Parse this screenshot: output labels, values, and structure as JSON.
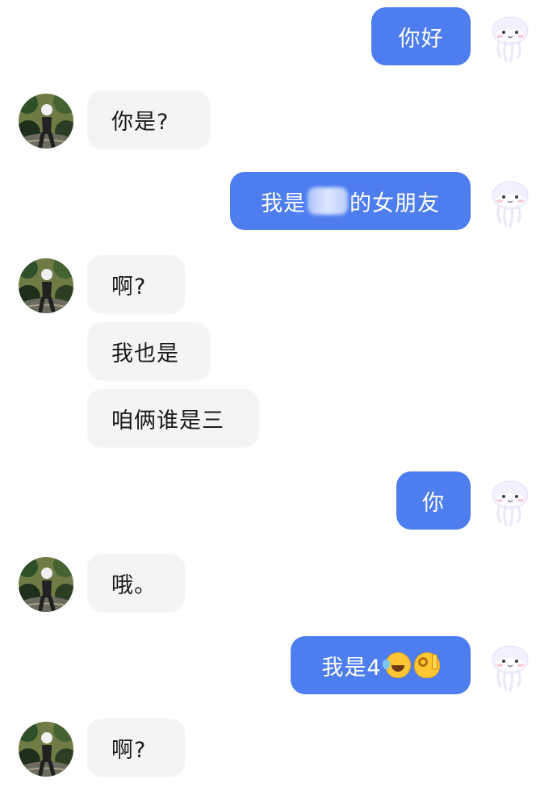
{
  "conversation": {
    "messages": [
      {
        "speaker": "me",
        "text": "你好"
      },
      {
        "speaker": "contact",
        "text": "你是?"
      },
      {
        "speaker": "me",
        "text_before": "我是",
        "text_after": "的女朋友"
      },
      {
        "speaker": "contact",
        "text": "啊?"
      },
      {
        "speaker": "contact",
        "text": "我也是"
      },
      {
        "speaker": "contact",
        "text": "咱俩谁是三"
      },
      {
        "speaker": "me",
        "text": "你"
      },
      {
        "speaker": "contact",
        "text": "哦。"
      },
      {
        "speaker": "me",
        "text": "我是4",
        "emojis": [
          "rolling-on-floor-laughing-icon",
          "ok-hand-icon"
        ]
      },
      {
        "speaker": "contact",
        "text": "啊?"
      }
    ]
  },
  "theme": {
    "background": "#ffffff",
    "outgoing_bubble": "#4e7df0",
    "incoming_bubble": "#f4f4f6",
    "outgoing_text": "#ffffff",
    "incoming_text": "#1a1a1a"
  }
}
